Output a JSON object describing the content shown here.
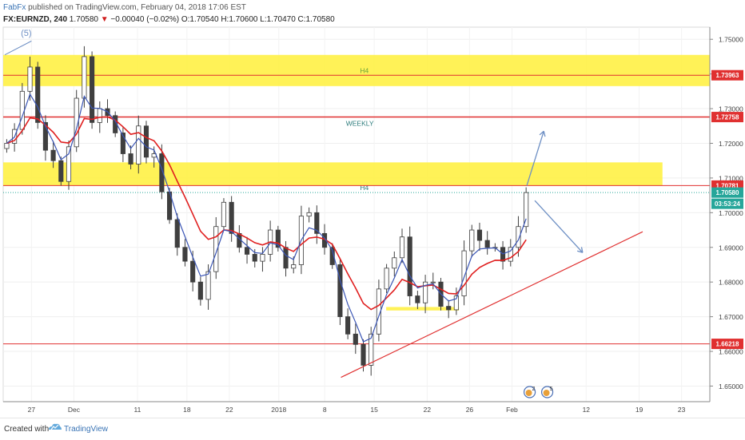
{
  "header": {
    "author": "FabFx",
    "published": "published on TradingView.com, February 04, 2018 17:06 EST",
    "symbol": "FX:EURNZD, 240",
    "last": "1.70580",
    "change": "−0.00040 (−0.02%)",
    "o_label": "O:",
    "o": "1.70540",
    "h_label": "H:",
    "h": "1.70600",
    "l_label": "L:",
    "l": "1.70470",
    "c_label": "C:",
    "c": "1.70580"
  },
  "footer": {
    "created_with": "Created with",
    "brand": "TradingView"
  },
  "colors": {
    "zone": "#fff03a",
    "level_line": "#e03030",
    "trendline": "#e03030",
    "candle": "#3f3f3f",
    "ma_fast": "#3a55b5",
    "ma_slow": "#e02020",
    "arrow": "#6d8fc4",
    "wave_label": "#6d8fc4",
    "zone_text_h4": "#6aa23a",
    "zone_text_weekly": "#2e7d7d"
  },
  "chart_data": {
    "type": "candlestick",
    "symbol": "FX:EURNZD",
    "timeframe": "240",
    "ylim": [
      1.6455,
      1.7535
    ],
    "y_ticks": [
      "1.75000",
      "1.74000",
      "1.73000",
      "1.72000",
      "1.71000",
      "1.70000",
      "1.69000",
      "1.68000",
      "1.67000",
      "1.66000",
      "1.65000"
    ],
    "x_ticks": [
      "27",
      "Dec",
      "11",
      "18",
      "22",
      "2018",
      "8",
      "15",
      "22",
      "26",
      "Feb",
      "12",
      "19",
      "23"
    ],
    "price_labels": [
      {
        "value": "1.73963",
        "color": "#e03030",
        "text_color": "#ffffff"
      },
      {
        "value": "1.72758",
        "color": "#e03030",
        "text_color": "#ffffff"
      },
      {
        "value": "1.70781",
        "color": "#e03030",
        "text_color": "#ffffff"
      },
      {
        "value": "1.70580",
        "color": "#26a69a",
        "text_color": "#ffffff"
      },
      {
        "value": "03:53:24",
        "color": "#26a69a",
        "text_color": "#ffffff"
      },
      {
        "value": "1.66218",
        "color": "#e03030",
        "text_color": "#ffffff"
      }
    ],
    "zones": [
      {
        "label": "H4",
        "y_top": 1.7455,
        "y_bottom": 1.7365
      },
      {
        "label": "H4",
        "y_top": 1.7145,
        "y_bottom": 1.7078
      },
      {
        "label": "",
        "y_top": 1.6728,
        "y_bottom": 1.6718
      }
    ],
    "levels": [
      {
        "label": "WEEKLY",
        "value": 1.72758
      },
      {
        "label": "",
        "value": 1.73963
      },
      {
        "label": "",
        "value": 1.70781
      },
      {
        "label": "",
        "value": 1.66218
      }
    ],
    "trendline": {
      "from": [
        0.478,
        1.6525
      ],
      "to": [
        0.905,
        1.6945
      ]
    },
    "wave_label": "(5)",
    "series_close": [
      1.72,
      1.724,
      1.735,
      1.742,
      1.726,
      1.718,
      1.715,
      1.709,
      1.719,
      1.733,
      1.745,
      1.726,
      1.73,
      1.728,
      1.723,
      1.717,
      1.714,
      1.725,
      1.716,
      1.717,
      1.706,
      1.698,
      1.69,
      1.686,
      1.68,
      1.675,
      1.683,
      1.696,
      1.703,
      1.694,
      1.69,
      1.688,
      1.686,
      1.688,
      1.695,
      1.69,
      1.684,
      1.685,
      1.699,
      1.7,
      1.694,
      1.69,
      1.685,
      1.67,
      1.665,
      1.662,
      1.656,
      1.665,
      1.678,
      1.684,
      1.687,
      1.693,
      1.676,
      1.674,
      1.68,
      1.68,
      1.673,
      1.672,
      1.676,
      1.689,
      1.695,
      1.692,
      1.69,
      1.69,
      1.686,
      1.69,
      1.696,
      1.7058
    ]
  }
}
